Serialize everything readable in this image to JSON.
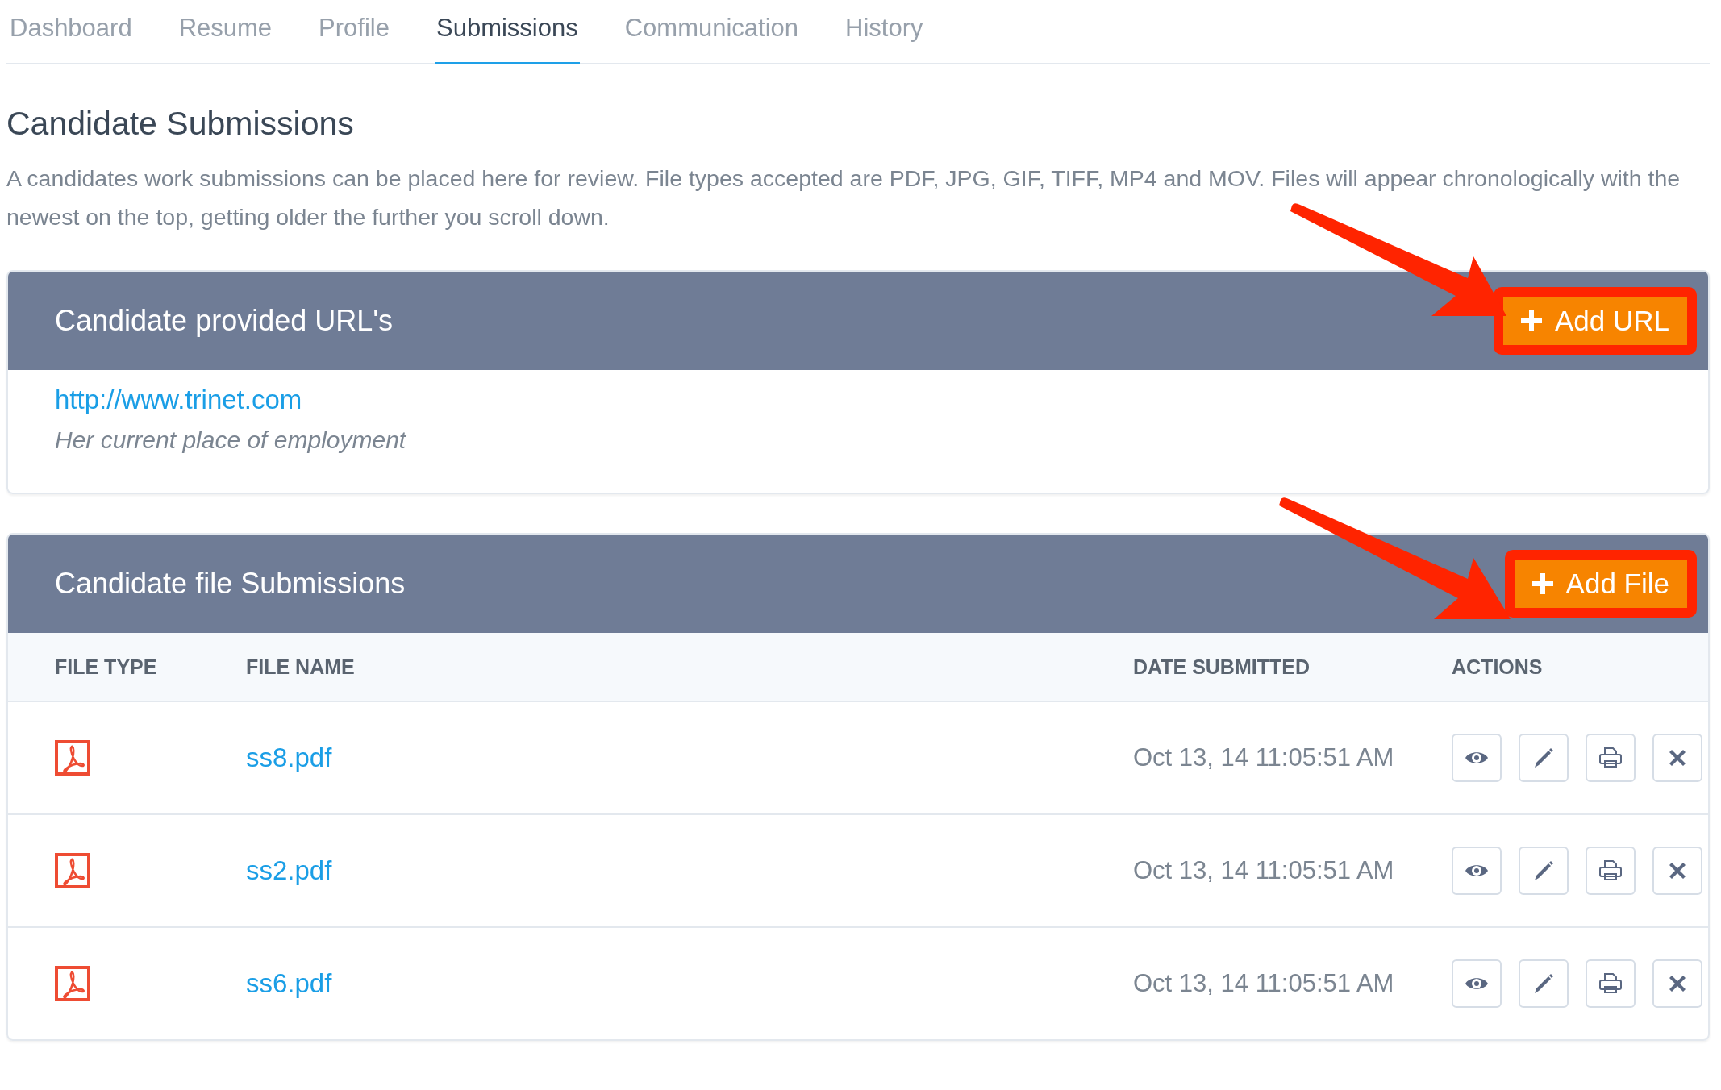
{
  "tabs": [
    {
      "label": "Dashboard",
      "selected": false
    },
    {
      "label": "Resume",
      "selected": false
    },
    {
      "label": "Profile",
      "selected": false
    },
    {
      "label": "Submissions",
      "selected": true
    },
    {
      "label": "Communication",
      "selected": false
    },
    {
      "label": "History",
      "selected": false
    }
  ],
  "heading": "Candidate Submissions",
  "description": "A candidates work submissions can be placed here for review. File types accepted are PDF, JPG, GIF, TIFF, MP4 and MOV. Files will appear chronologically with the newest on the top, getting older the further you scroll down.",
  "url_panel": {
    "title": "Candidate provided URL's",
    "add_button": "Add URL",
    "highlighted": true,
    "links": [
      {
        "url": "http://www.trinet.com",
        "note": "Her current place of employment"
      }
    ]
  },
  "file_panel": {
    "title": "Candidate file Submissions",
    "add_button": "Add File",
    "highlighted": true,
    "columns": [
      "FILE TYPE",
      "FILE NAME",
      "DATE SUBMITTED",
      "ACTIONS"
    ],
    "rows": [
      {
        "name": "ss8.pdf",
        "date": "Oct 13, 14 11:05:51 AM"
      },
      {
        "name": "ss2.pdf",
        "date": "Oct 13, 14 11:05:51 AM"
      },
      {
        "name": "ss6.pdf",
        "date": "Oct 13, 14 11:05:51 AM"
      }
    ]
  }
}
